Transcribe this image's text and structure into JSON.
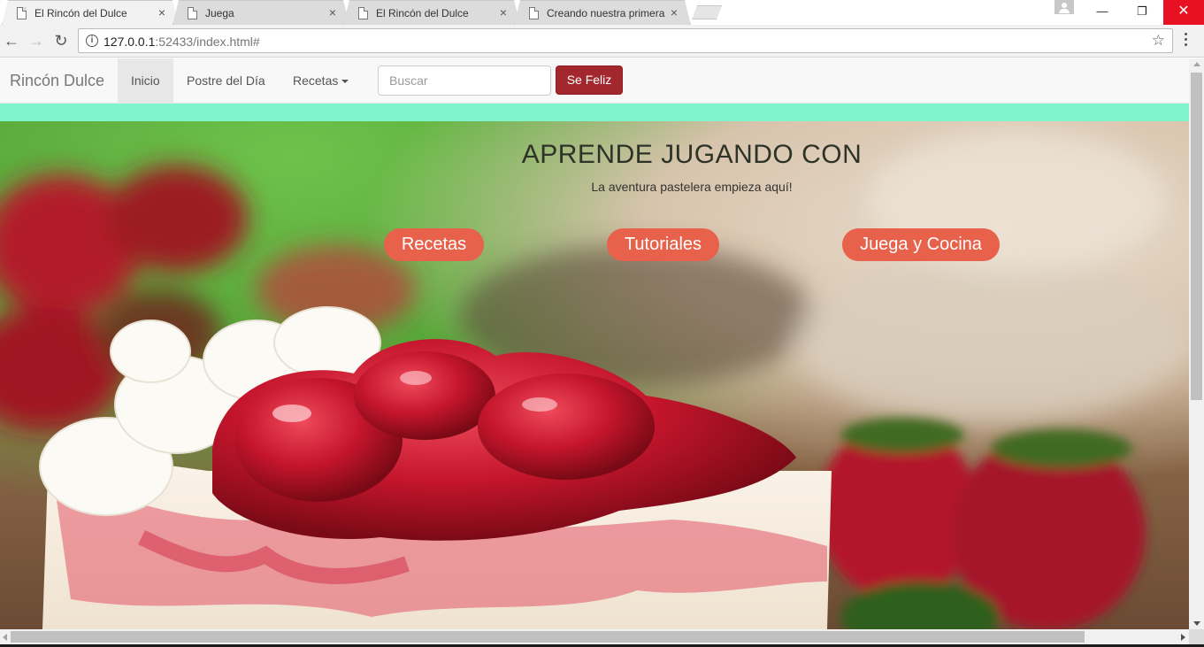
{
  "browser": {
    "tabs": [
      {
        "title": "El Rincón del Dulce",
        "active": true
      },
      {
        "title": "Juega",
        "active": false
      },
      {
        "title": "El Rincón del Dulce",
        "active": false
      },
      {
        "title": "Creando nuestra primera",
        "active": false
      }
    ],
    "tab_close_glyph": "×",
    "window": {
      "minimize": "—",
      "restore": "❐",
      "close": "✕"
    },
    "url_host": "127.0.0.1",
    "url_rest": ":52433/index.html#",
    "info_glyph": "i",
    "star_glyph": "☆",
    "back_glyph": "←",
    "forward_glyph": "→",
    "reload_glyph": "↻"
  },
  "navbar": {
    "brand": "Rincón Dulce",
    "items": [
      {
        "label": "Inicio",
        "active": true
      },
      {
        "label": "Postre del Día",
        "active": false
      },
      {
        "label": "Recetas",
        "active": false,
        "dropdown": true
      }
    ],
    "search_placeholder": "Buscar",
    "happy_button": "Se Feliz"
  },
  "hero": {
    "title": "APRENDE JUGANDO CON",
    "subtitle": "La aventura pastelera empieza aquí!",
    "buttons": [
      "Recetas",
      "Tutoriales",
      "Juega y Cocina"
    ]
  },
  "colors": {
    "mint_band": "#7ff5ce",
    "happy_button": "#a3282e",
    "pill": "#e8614a",
    "window_close": "#e81123"
  }
}
